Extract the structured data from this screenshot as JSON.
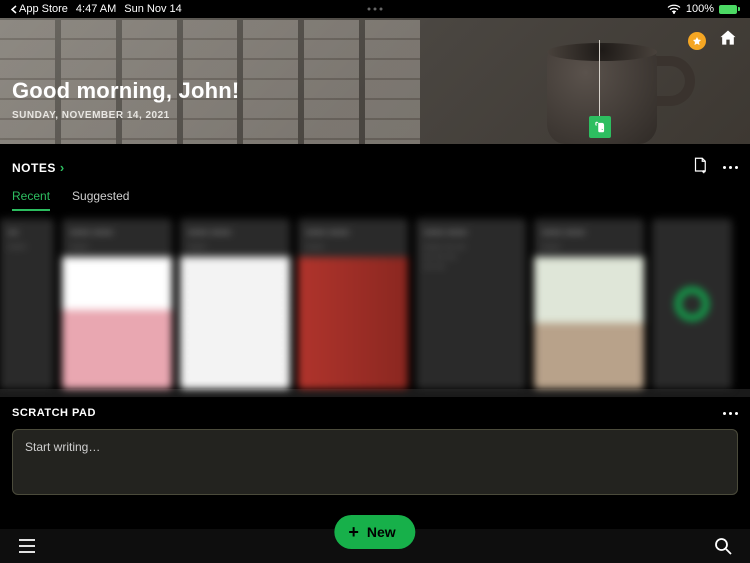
{
  "statusBar": {
    "backApp": "App Store",
    "time": "4:47 AM",
    "date": "Sun Nov 14",
    "batteryPercent": "100%"
  },
  "hero": {
    "greeting": "Good morning, John!",
    "dateLong": "SUNDAY, NOVEMBER 14, 2021"
  },
  "notes": {
    "sectionTitle": "NOTES",
    "tabs": {
      "recent": "Recent",
      "suggested": "Suggested"
    },
    "activeTab": "recent"
  },
  "scratch": {
    "title": "SCRATCH PAD",
    "placeholder": "Start writing…"
  },
  "newButton": {
    "label": "New"
  }
}
